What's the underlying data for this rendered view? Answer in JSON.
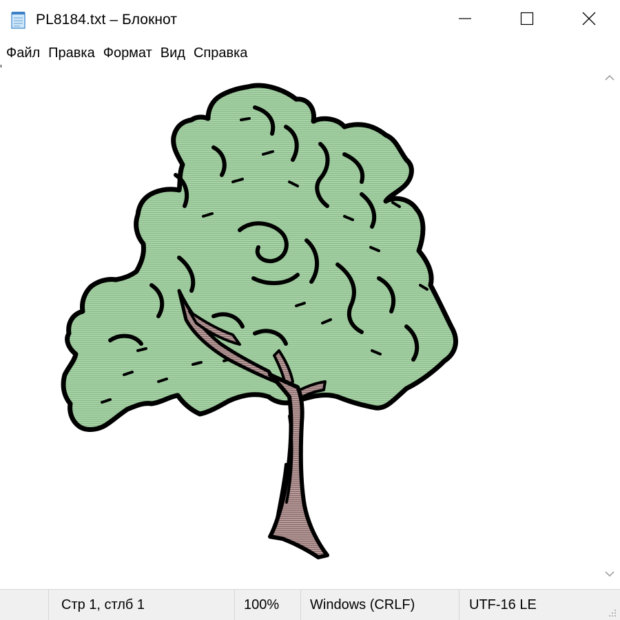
{
  "window": {
    "title": "PL8184.txt – Блокнот"
  },
  "menu": {
    "items": [
      "Файл",
      "Правка",
      "Формат",
      "Вид",
      "Справка"
    ]
  },
  "editor": {
    "content_description_icon": "ascii-art-tree",
    "colors": {
      "foliage": "#a6d2a6",
      "outline": "#000000",
      "trunk": "#b89a9a"
    }
  },
  "status": {
    "position": "Стр 1, стлб 1",
    "zoom": "100%",
    "line_endings": "Windows (CRLF)",
    "encoding": "UTF-16 LE"
  },
  "icons": {
    "app": "notepad-icon",
    "minimize": "minimize-icon",
    "maximize": "maximize-icon",
    "close": "close-icon",
    "scroll_up": "chevron-up-icon",
    "scroll_down": "chevron-down-icon",
    "grip": "resize-grip-icon"
  }
}
